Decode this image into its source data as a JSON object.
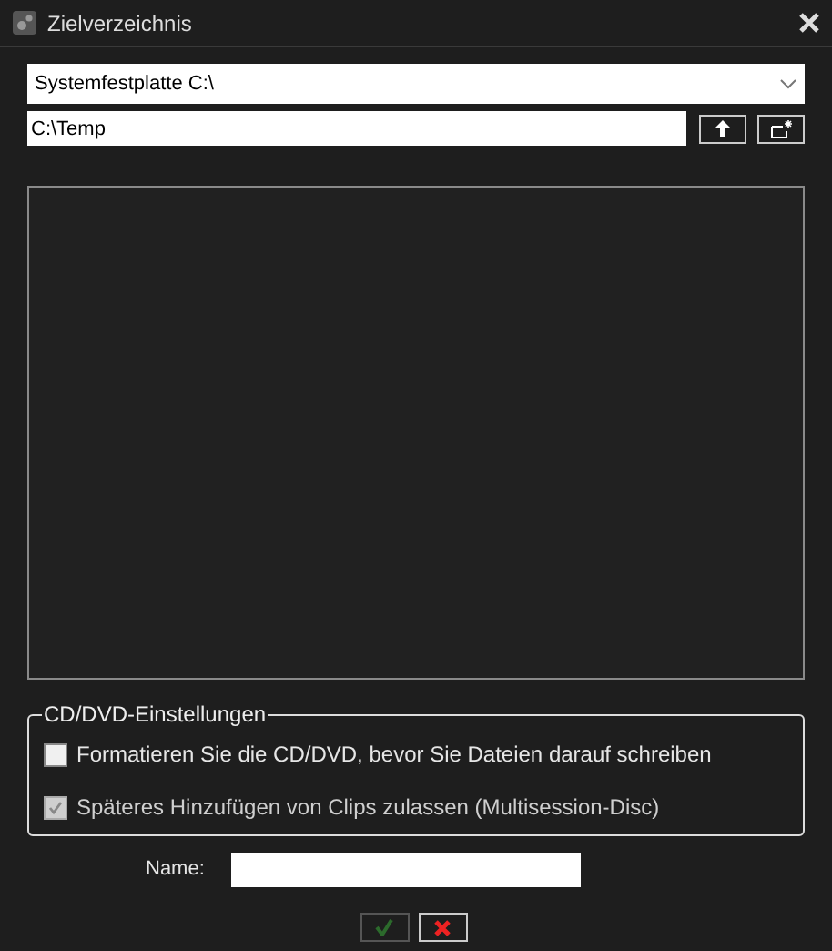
{
  "window": {
    "title": "Zielverzeichnis"
  },
  "drive_select": {
    "value": "Systemfestplatte C:\\"
  },
  "path_field": {
    "value": "C:\\Temp"
  },
  "cd_settings": {
    "title": "CD/DVD-Einstellungen",
    "options": [
      {
        "label": "Formatieren Sie die CD/DVD, bevor Sie Dateien darauf schreiben",
        "checked": false,
        "disabled": false
      },
      {
        "label": "Späteres Hinzufügen von Clips zulassen (Multisession-Disc)",
        "checked": true,
        "disabled": true
      }
    ]
  },
  "name_field": {
    "label": "Name:"
  },
  "ok_button": {
    "disabled": true
  }
}
